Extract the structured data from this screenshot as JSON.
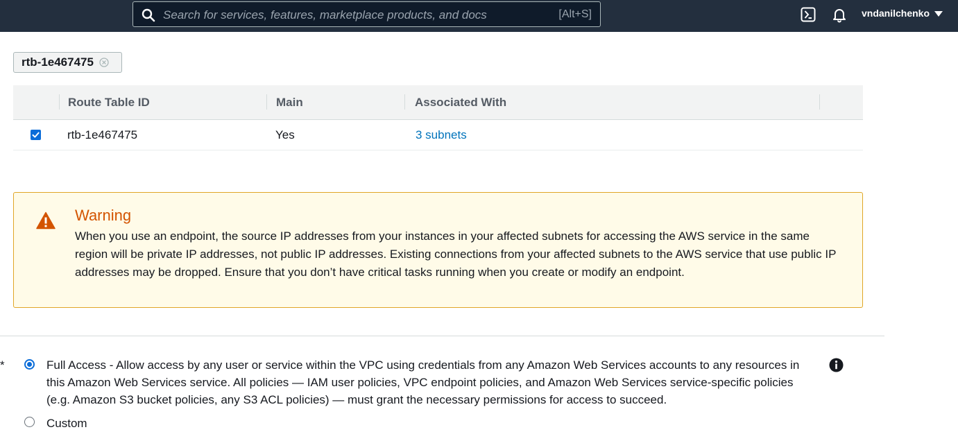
{
  "topnav": {
    "search_placeholder": "Search for services, features, marketplace products, and docs",
    "search_shortcut": "[Alt+S]",
    "username": "vndanilchenko",
    "icons": [
      "search-icon",
      "cloudshell-icon",
      "bell-icon",
      "caret-down-icon"
    ]
  },
  "filter": {
    "token_label": "rtb-1e467475"
  },
  "table": {
    "columns": [
      "Route Table ID",
      "Main",
      "Associated With"
    ],
    "rows": [
      {
        "selected": true,
        "id": "rtb-1e467475",
        "main": "Yes",
        "associated": "3 subnets"
      }
    ]
  },
  "warning": {
    "title": "Warning",
    "body": "When you use an endpoint, the source IP addresses from your instances in your affected subnets for accessing the AWS service in the same region will be private IP addresses, not public IP addresses. Existing connections from your affected subnets to the AWS service that use public IP addresses may be dropped. Ensure that you don’t have critical tasks running when you create or modify an endpoint."
  },
  "policy": {
    "required_mark": "*",
    "options": [
      {
        "label": "Full Access - Allow access by any user or service within the VPC using credentials from any Amazon Web Services accounts to any resources in this Amazon Web Services service. All policies — IAM user policies, VPC endpoint policies, and Amazon Web Services service-specific policies (e.g. Amazon S3 bucket policies, any S3 ACL policies) — must grant the necessary permissions for access to succeed.",
        "selected": true
      },
      {
        "label": "Custom",
        "selected": false
      }
    ]
  },
  "colors": {
    "nav_bg": "#232f3e",
    "link": "#0073bb",
    "accent": "#0a6cd8",
    "warning_title": "#d35400",
    "warning_bg": "#fffbe8",
    "warning_border": "#e0a526"
  }
}
